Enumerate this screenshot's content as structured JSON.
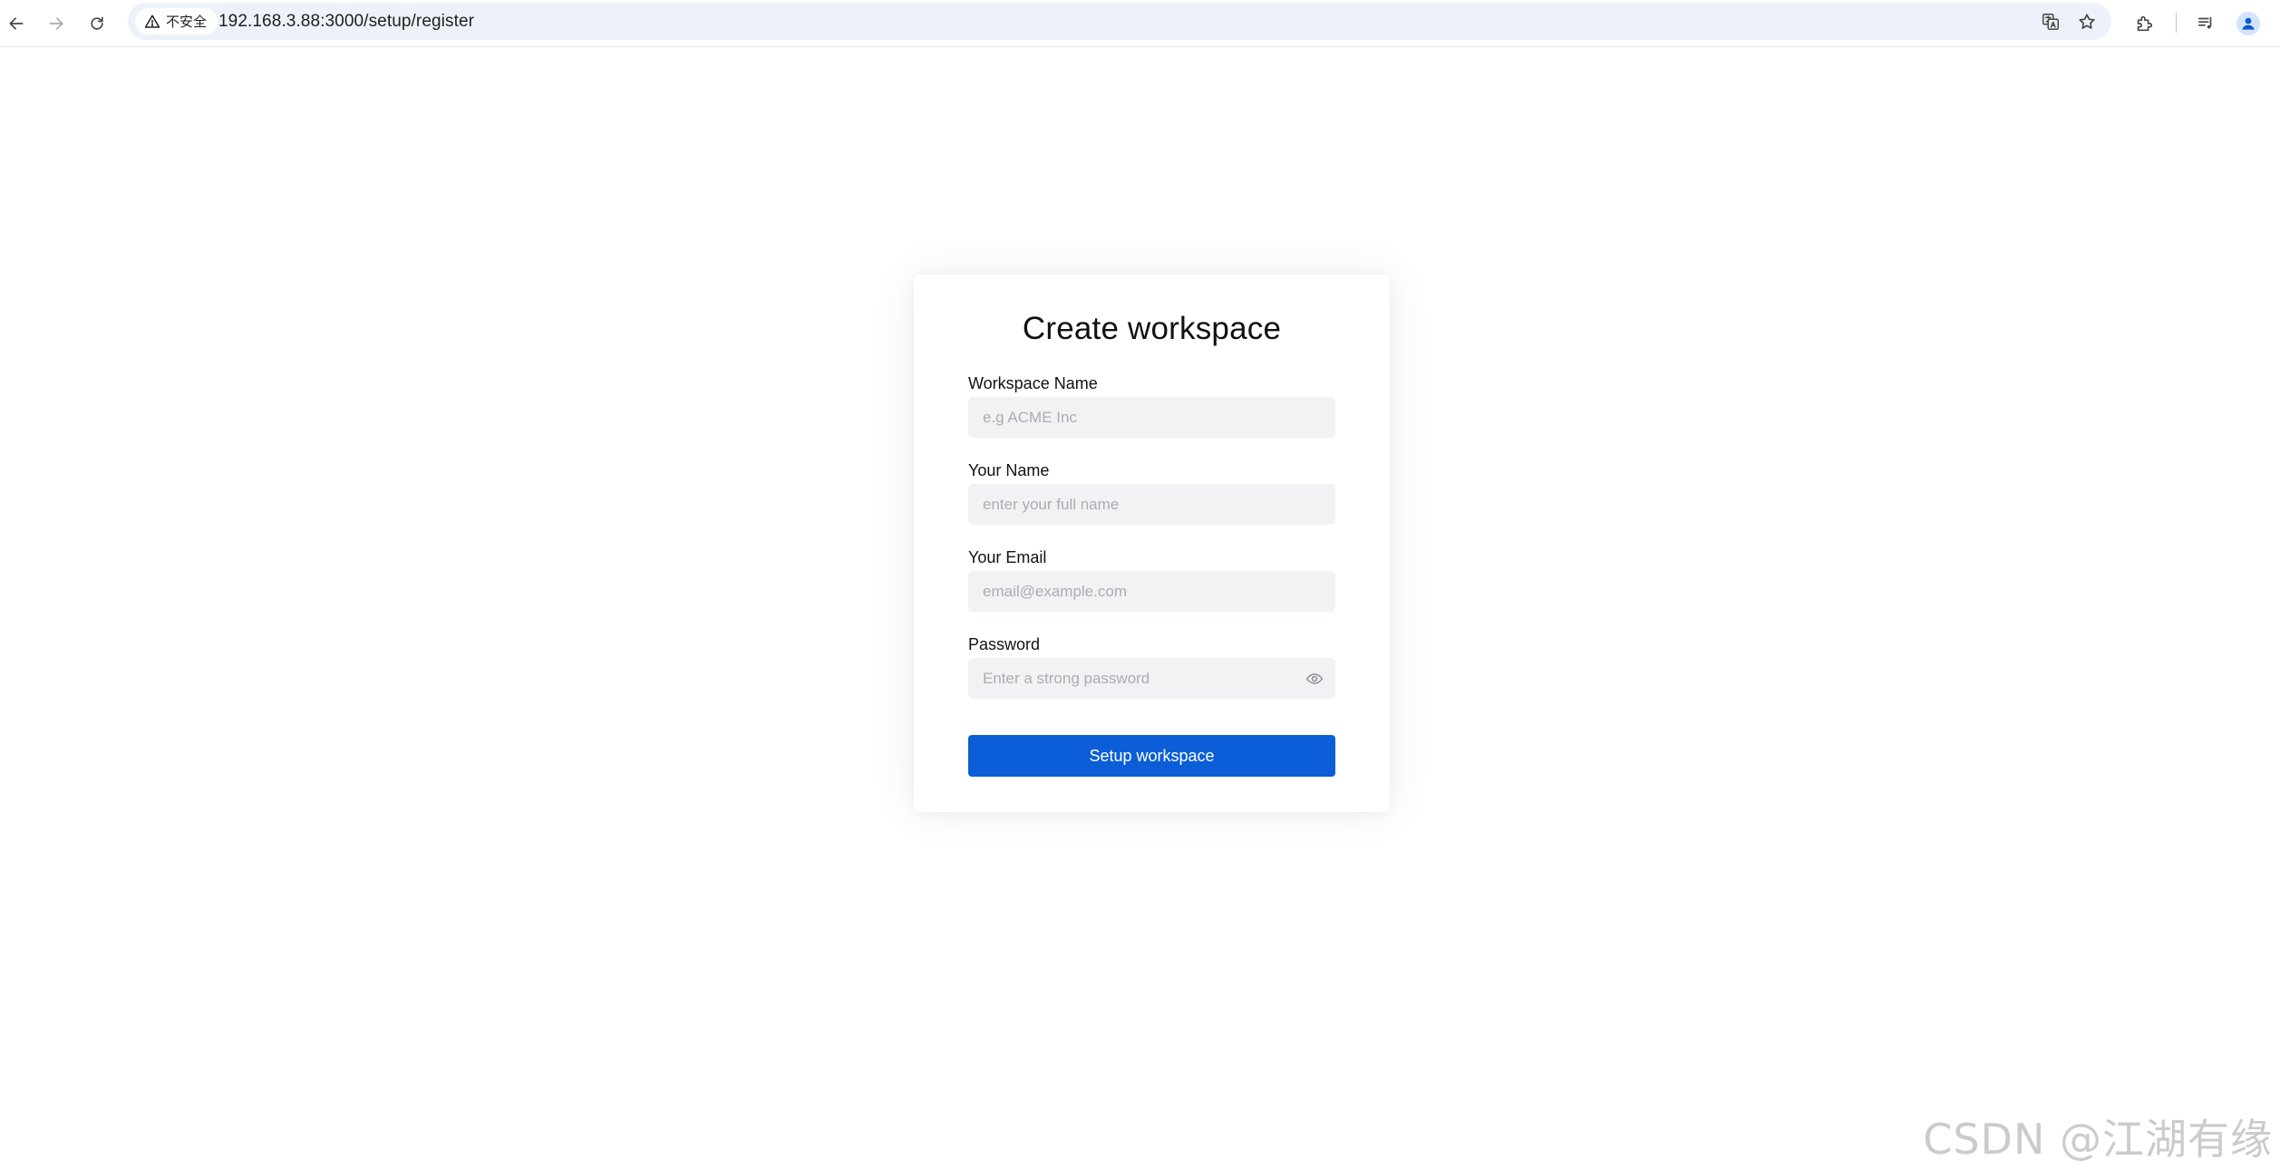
{
  "browser": {
    "security_label": "不安全",
    "url": "192.168.3.88:3000/setup/register",
    "icons": [
      "back-icon",
      "forward-icon",
      "reload-icon",
      "warning-icon",
      "translate-icon",
      "bookmark-star-icon",
      "extensions-icon",
      "media-controls-icon",
      "profile-icon"
    ]
  },
  "form": {
    "title": "Create workspace",
    "workspace_name": {
      "label": "Workspace Name",
      "placeholder": "e.g ACME Inc"
    },
    "your_name": {
      "label": "Your Name",
      "placeholder": "enter your full name"
    },
    "email": {
      "label": "Your Email",
      "placeholder": "email@example.com"
    },
    "password": {
      "label": "Password",
      "placeholder": "Enter a strong password"
    },
    "submit_label": "Setup workspace"
  },
  "watermark": "CSDN @江湖有缘",
  "colors": {
    "primary_button": "#0b5ed7",
    "input_bg": "#f1f2f4",
    "omnibox_bg": "#edf2fa"
  }
}
